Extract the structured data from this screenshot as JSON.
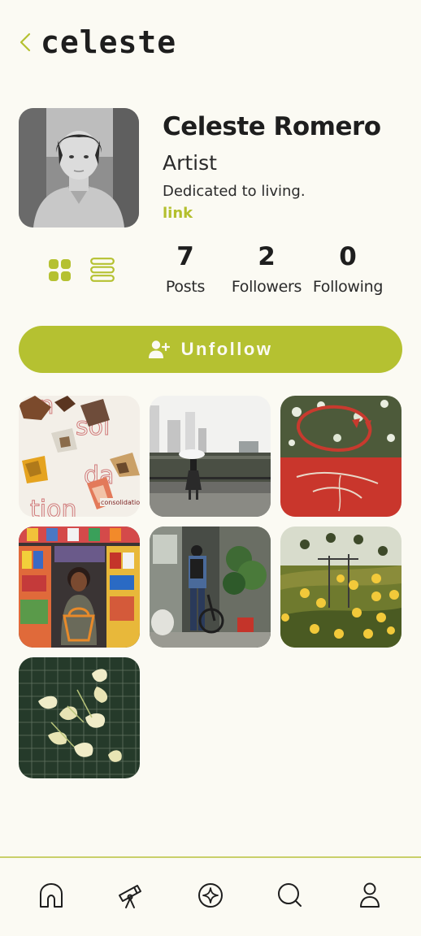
{
  "header": {
    "back_icon": "chevron-left-icon",
    "logo_text": "celeste"
  },
  "profile": {
    "name": "Celeste Romero",
    "role": "Artist",
    "bio": "Dedicated to living.",
    "link_label": "link",
    "avatar_icon": "avatar-portrait"
  },
  "view_toggle": {
    "grid_icon": "grid-icon",
    "list_icon": "list-icon"
  },
  "stats": [
    {
      "value": "7",
      "label": "Posts"
    },
    {
      "value": "2",
      "label": "Followers"
    },
    {
      "value": "0",
      "label": "Following"
    }
  ],
  "actions": {
    "unfollow_label": "Unfollow",
    "unfollow_icon": "user-plus-icon"
  },
  "posts": {
    "tile1_caption": "consolidation"
  },
  "colors": {
    "accent": "#b5c131",
    "background": "#fbfaf3",
    "text": "#1e1e1e"
  },
  "nav": [
    {
      "icon": "home-icon"
    },
    {
      "icon": "telescope-icon"
    },
    {
      "icon": "explore-compass-icon"
    },
    {
      "icon": "search-icon"
    },
    {
      "icon": "profile-icon"
    }
  ]
}
